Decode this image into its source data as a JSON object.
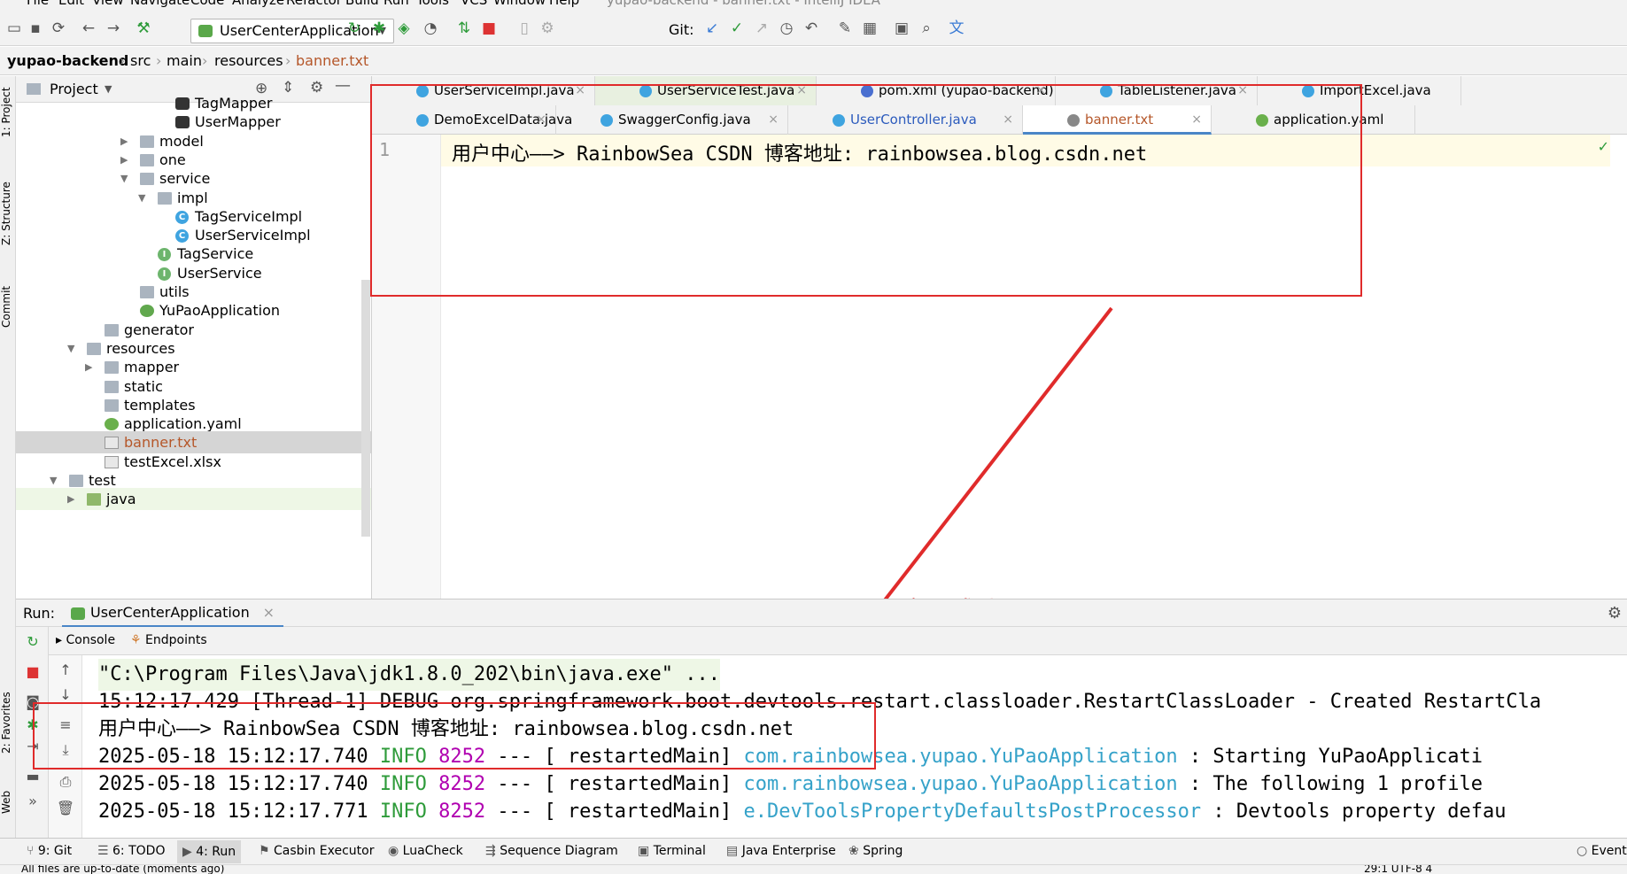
{
  "menu": [
    "File",
    "Edit",
    "View",
    "Navigate",
    "Code",
    "Analyze",
    "Refactor",
    "Build",
    "Run",
    "Tools",
    "VCS",
    "Window",
    "Help"
  ],
  "window_title": "yupao-backend - banner.txt - IntelliJ IDEA",
  "toolbar": {
    "run_config": "UserCenterApplication",
    "git_label": "Git:"
  },
  "breadcrumbs": [
    "yupao-backend",
    "src",
    "main",
    "resources",
    "banner.txt"
  ],
  "left_strip": {
    "project": "1: Project",
    "structure": "Z: Structure",
    "commit": "Commit",
    "favorites": "2: Favorites",
    "web": "Web"
  },
  "project_panel": {
    "title": "Project",
    "tree": [
      {
        "label": "TagMapper",
        "icon": "mapper-icon"
      },
      {
        "label": "UserMapper",
        "icon": "mapper-icon"
      },
      {
        "label": "model",
        "icon": "folder-icon",
        "collapsed": true
      },
      {
        "label": "one",
        "icon": "folder-icon",
        "collapsed": true
      },
      {
        "label": "service",
        "icon": "folder-icon",
        "expanded": true
      },
      {
        "label": "impl",
        "icon": "folder-icon",
        "expanded": true
      },
      {
        "label": "TagServiceImpl",
        "icon": "class-icon"
      },
      {
        "label": "UserServiceImpl",
        "icon": "class-icon"
      },
      {
        "label": "TagService",
        "icon": "interface-icon"
      },
      {
        "label": "UserService",
        "icon": "interface-icon"
      },
      {
        "label": "utils",
        "icon": "folder-icon"
      },
      {
        "label": "YuPaoApplication",
        "icon": "spring-app-icon"
      },
      {
        "label": "generator",
        "icon": "folder-icon"
      },
      {
        "label": "resources",
        "icon": "folder-icon",
        "expanded": true
      },
      {
        "label": "mapper",
        "icon": "folder-icon",
        "collapsed": true
      },
      {
        "label": "static",
        "icon": "folder-icon"
      },
      {
        "label": "templates",
        "icon": "folder-icon"
      },
      {
        "label": "application.yaml",
        "icon": "yaml-icon"
      },
      {
        "label": "banner.txt",
        "icon": "text-file-icon",
        "selected": true
      },
      {
        "label": "testExcel.xlsx",
        "icon": "text-file-icon"
      },
      {
        "label": "test",
        "icon": "folder-icon",
        "expanded": true
      },
      {
        "label": "java",
        "icon": "folder-icon",
        "collapsed": true
      }
    ]
  },
  "editor_tabs_row1": [
    {
      "label": "UserServiceImpl.java"
    },
    {
      "label": "UserServiceTest.java"
    },
    {
      "label": "pom.xml (yupao-backend)"
    },
    {
      "label": "TableListener.java"
    },
    {
      "label": "ImportExcel.java"
    }
  ],
  "editor_tabs_row2": [
    {
      "label": "DemoExcelData.java"
    },
    {
      "label": "SwaggerConfig.java"
    },
    {
      "label": "UserController.java"
    },
    {
      "label": "banner.txt",
      "active": true
    },
    {
      "label": "application.yaml"
    }
  ],
  "editor": {
    "line_number": "1",
    "code": "用户中心——> RainbowSea CSDN 博客地址: rainbowsea.blog.csdn.net"
  },
  "annotation": "实现成功",
  "run_panel": {
    "label": "Run:",
    "tab": "UserCenterApplication",
    "console_tab": "Console",
    "endpoints_tab": "Endpoints",
    "lines": [
      {
        "text": "\"C:\\Program Files\\Java\\jdk1.8.0_202\\bin\\java.exe\" ..."
      },
      {
        "text": "15:12:17.429 [Thread-1] DEBUG org.springframework.boot.devtools.restart.classloader.RestartClassLoader - Created RestartCla"
      },
      {
        "text": "用户中心——> RainbowSea CSDN 博客地址: rainbowsea.blog.csdn.net"
      },
      {
        "date": "2025-05-18 15:12:17.740",
        "level": "INFO",
        "pid": "8252",
        "thread": "--- [  restartedMain]",
        "cls": "com.rainbowsea.yupao.YuPaoApplication   ",
        "msg": ": Starting YuPaoApplicati"
      },
      {
        "date": "2025-05-18 15:12:17.740",
        "level": "INFO",
        "pid": "8252",
        "thread": "--- [  restartedMain]",
        "cls": "com.rainbowsea.yupao.YuPaoApplication   ",
        "msg": ": The following 1 profile"
      },
      {
        "date": "2025-05-18 15:12:17.771",
        "level": "INFO",
        "pid": "8252",
        "thread": "--- [  restartedMain]",
        "cls": " e.DevToolsPropertyDefaultsPostProcessor",
        "msg": ": Devtools property defau"
      }
    ]
  },
  "bottom_tools": [
    {
      "label": "9: Git"
    },
    {
      "label": "6: TODO"
    },
    {
      "label": "4: Run",
      "selected": true
    },
    {
      "label": "Casbin Executor"
    },
    {
      "label": "LuaCheck"
    },
    {
      "label": "Sequence Diagram"
    },
    {
      "label": "Terminal"
    },
    {
      "label": "Java Enterprise"
    },
    {
      "label": "Spring"
    },
    {
      "label": "Event"
    }
  ],
  "status": {
    "left": "All files are up-to-date (moments ago)",
    "right": "29:1  UTF-8  4"
  },
  "colors": {
    "accent": "#4a86c7",
    "annotation_red": "#e02b2b",
    "info_green": "#2e9b3a",
    "pid_magenta": "#b000b0",
    "class_cyan": "#35a2c9"
  }
}
